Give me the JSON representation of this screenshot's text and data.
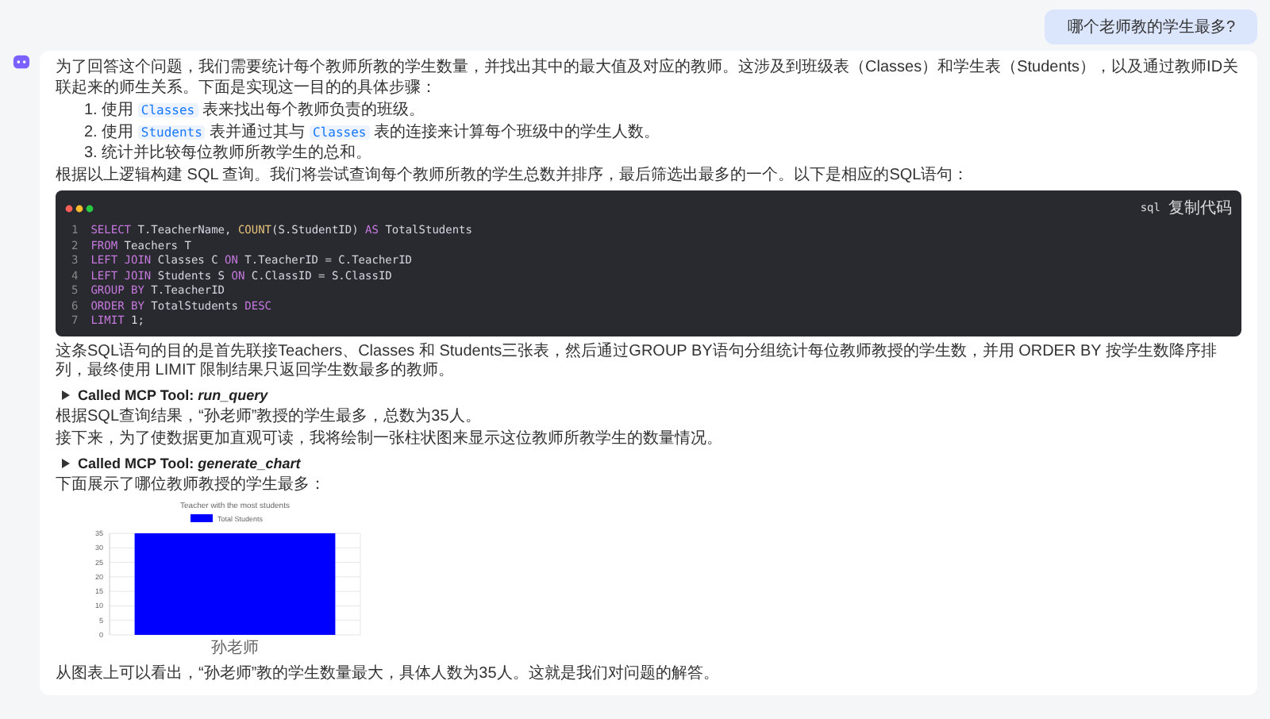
{
  "user_message": "哪个老师教的学生最多?",
  "answer": {
    "intro": "为了回答这个问题，我们需要统计每个教师所教的学生数量，并找出其中的最大值及对应的教师。这涉及到班级表（Classes）和学生表（Students），以及通过教师ID关联起来的师生关系。下面是实现这一目的的具体步骤：",
    "steps": [
      {
        "number": "1.",
        "parts": [
          {
            "kind": "text",
            "text": "使用 "
          },
          {
            "kind": "code",
            "text": "Classes"
          },
          {
            "kind": "text",
            "text": " 表来找出每个教师负责的班级。"
          }
        ]
      },
      {
        "number": "2.",
        "parts": [
          {
            "kind": "text",
            "text": "使用 "
          },
          {
            "kind": "code",
            "text": "Students"
          },
          {
            "kind": "text",
            "text": " 表并通过其与 "
          },
          {
            "kind": "code",
            "text": "Classes"
          },
          {
            "kind": "text",
            "text": " 表的连接来计算每个班级中的学生人数。"
          }
        ]
      },
      {
        "number": "3.",
        "parts": [
          {
            "kind": "text",
            "text": "统计并比较每位教师所教学生的总和。"
          }
        ]
      }
    ],
    "lead": "根据以上逻辑构建 SQL 查询。我们将尝试查询每个教师所教的学生总数并排序，最后筛选出最多的一个。以下是相应的SQL语句：",
    "code_block": {
      "language": "sql",
      "copy_label": "复制代码",
      "lines": [
        {
          "number": "1",
          "tokens": [
            {
              "kind": "keyword",
              "text": "SELECT"
            },
            {
              "kind": "plain",
              "text": " T.TeacherName, "
            },
            {
              "kind": "function",
              "text": "COUNT"
            },
            {
              "kind": "plain",
              "text": "(S.StudentID) "
            },
            {
              "kind": "keyword",
              "text": "AS"
            },
            {
              "kind": "plain",
              "text": " TotalStudents"
            }
          ]
        },
        {
          "number": "2",
          "tokens": [
            {
              "kind": "keyword",
              "text": "FROM"
            },
            {
              "kind": "plain",
              "text": " Teachers T"
            }
          ]
        },
        {
          "number": "3",
          "tokens": [
            {
              "kind": "keyword",
              "text": "LEFT JOIN"
            },
            {
              "kind": "plain",
              "text": " Classes C "
            },
            {
              "kind": "keyword",
              "text": "ON"
            },
            {
              "kind": "plain",
              "text": " T.TeacherID = C.TeacherID"
            }
          ]
        },
        {
          "number": "4",
          "tokens": [
            {
              "kind": "keyword",
              "text": "LEFT JOIN"
            },
            {
              "kind": "plain",
              "text": " Students S "
            },
            {
              "kind": "keyword",
              "text": "ON"
            },
            {
              "kind": "plain",
              "text": " C.ClassID = S.ClassID"
            }
          ]
        },
        {
          "number": "5",
          "tokens": [
            {
              "kind": "keyword",
              "text": "GROUP BY"
            },
            {
              "kind": "plain",
              "text": " T.TeacherID"
            }
          ]
        },
        {
          "number": "6",
          "tokens": [
            {
              "kind": "keyword",
              "text": "ORDER BY"
            },
            {
              "kind": "plain",
              "text": " TotalStudents "
            },
            {
              "kind": "keyword",
              "text": "DESC"
            }
          ]
        },
        {
          "number": "7",
          "tokens": [
            {
              "kind": "keyword",
              "text": "LIMIT"
            },
            {
              "kind": "plain",
              "text": " 1;"
            }
          ]
        }
      ]
    },
    "blocks": [
      {
        "kind": "text",
        "text": "这条SQL语句的目的是首先联接Teachers、Classes 和 Students三张表，然后通过GROUP BY语句分组统计每位教师教授的学生数，并用 ORDER BY 按学生数降序排列，最终使用 LIMIT 限制结果只返回学生数最多的教师。"
      },
      {
        "kind": "tool",
        "text": "Called MCP Tool: *run_query*"
      },
      {
        "kind": "text",
        "text": "根据SQL查询结果，“孙老师”教授的学生最多，总数为35人。"
      },
      {
        "kind": "text",
        "text": "接下来，为了使数据更加直观可读，我将绘制一张柱状图来显示这位教师所教学生的数量情况。"
      },
      {
        "kind": "tool",
        "text": "Called MCP Tool: *generate_chart*"
      },
      {
        "kind": "text",
        "text": "下面展示了哪位教师教授的学生最多："
      },
      {
        "kind": "chart",
        "chart_data": {
          "type": "bar",
          "title": "Teacher with the most students",
          "categories": [
            "孙老师"
          ],
          "series": [
            {
              "name": "Total Students",
              "color": "#0000ff",
              "values": [
                35
              ]
            }
          ],
          "ylim": [
            0,
            35
          ],
          "grid": true,
          "yticks": [
            0,
            5,
            10,
            15,
            20,
            25,
            30,
            35
          ]
        }
      },
      {
        "kind": "text",
        "text": "从图表上可以看出，“孙老师”教的学生数量最大，具体人数为35人。这就是我们对问题的解答。"
      }
    ]
  }
}
